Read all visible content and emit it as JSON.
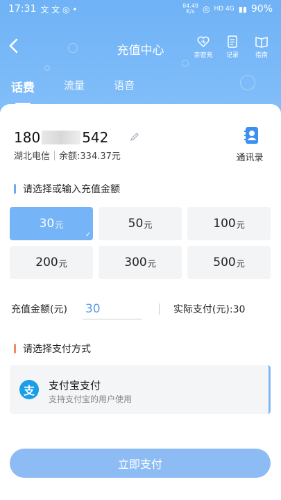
{
  "status_bar": {
    "time": "17:31",
    "net_speed_value": "84.49",
    "net_speed_unit": "K/s",
    "network": "HD 4G",
    "battery": "90%"
  },
  "nav": {
    "title": "充值中心",
    "actions": [
      {
        "label": "亲密充",
        "icon": "heart-icon"
      },
      {
        "label": "记录",
        "icon": "record-icon"
      },
      {
        "label": "指南",
        "icon": "guide-book-icon"
      }
    ]
  },
  "tabs": [
    {
      "label": "话费",
      "active": true
    },
    {
      "label": "流量",
      "active": false
    },
    {
      "label": "语音",
      "active": false
    }
  ],
  "phone": {
    "number_prefix": "180",
    "number_suffix": "542",
    "carrier": "湖北电信",
    "balance": "余额:334.37元"
  },
  "contacts": {
    "label": "通讯录",
    "icon": "address-book-icon"
  },
  "amount_section": {
    "title": "请选择或输入充值金额",
    "bar_color": "#6fa8f0",
    "options": [
      {
        "value": "30",
        "unit": "元",
        "selected": true
      },
      {
        "value": "50",
        "unit": "元",
        "selected": false
      },
      {
        "value": "100",
        "unit": "元",
        "selected": false
      },
      {
        "value": "200",
        "unit": "元",
        "selected": false
      },
      {
        "value": "300",
        "unit": "元",
        "selected": false
      },
      {
        "value": "500",
        "unit": "元",
        "selected": false
      }
    ]
  },
  "recharge": {
    "label": "充值金额(元)",
    "value": "30",
    "actual_pay": "实际支付(元):30"
  },
  "payment_section": {
    "title": "请选择支付方式",
    "bar_color": "#f08a5d",
    "method_name": "支付宝支付",
    "method_desc": "支持支付宝的用户使用",
    "logo_char": "支"
  },
  "pay_button": "立即支付"
}
